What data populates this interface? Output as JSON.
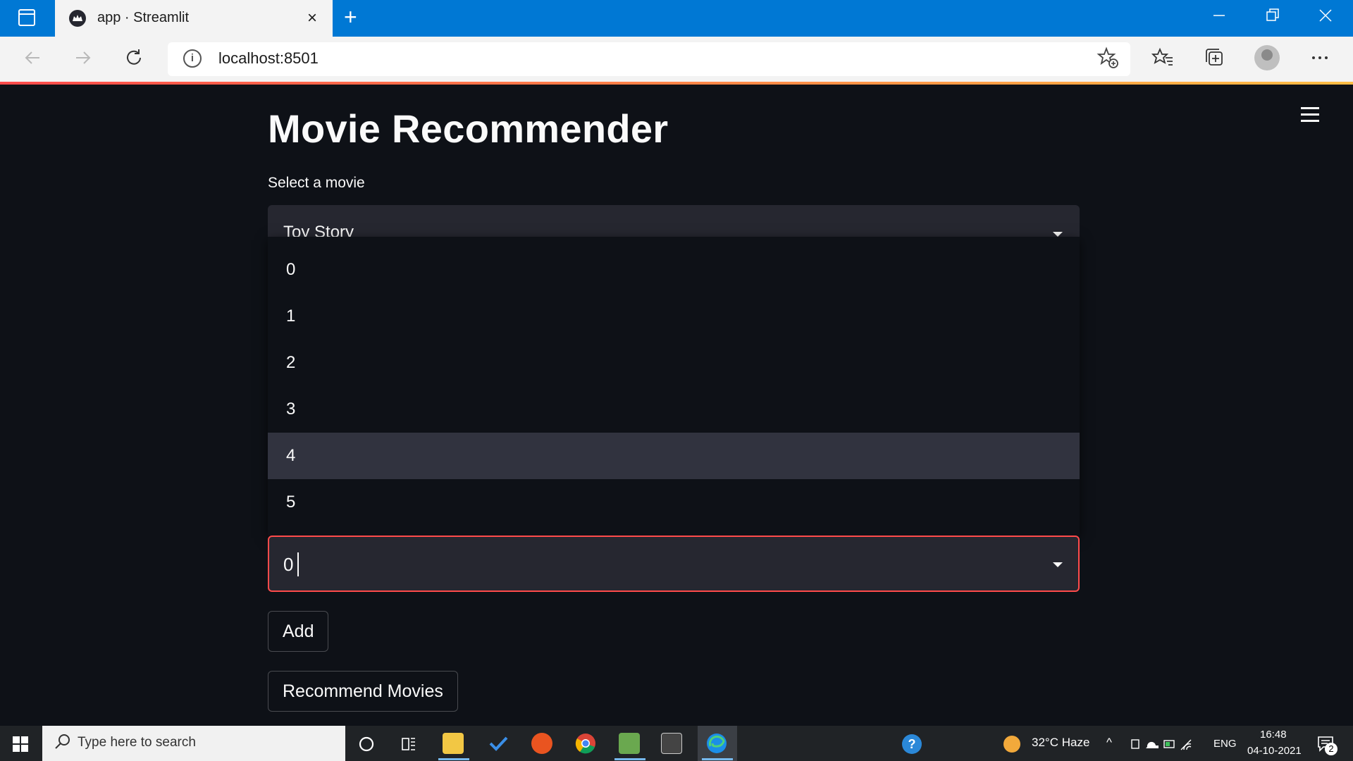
{
  "browser": {
    "tab_title": "app · Streamlit",
    "url": "localhost:8501",
    "new_tab": "+",
    "close": "×"
  },
  "app": {
    "title": "Movie Recommender",
    "select_label": "Select a movie",
    "selected_movie": "Toy Story",
    "dropdown_options": [
      "0",
      "1",
      "2",
      "3",
      "4",
      "5"
    ],
    "highlighted_option": "4",
    "rating_input_value": "0",
    "add_button": "Add",
    "recommend_button": "Recommend Movies"
  },
  "taskbar": {
    "search_placeholder": "Type here to search",
    "weather": "32°C  Haze",
    "language": "ENG",
    "time": "16:48",
    "date": "04-10-2021",
    "notification_count": "2"
  },
  "colors": {
    "accent": "#ff4b4b",
    "background": "#0e1117",
    "input_bg": "#262730",
    "browser_blue": "#0078d4"
  },
  "icons": [
    "streamlit-icon",
    "back-arrow-icon",
    "forward-arrow-icon",
    "refresh-icon",
    "info-icon",
    "favorite-add-icon",
    "favorites-icon",
    "collections-icon",
    "profile-icon",
    "more-icon",
    "hamburger-icon",
    "chevron-down-icon",
    "windows-icon",
    "search-icon",
    "cortana-icon",
    "task-view-icon"
  ]
}
